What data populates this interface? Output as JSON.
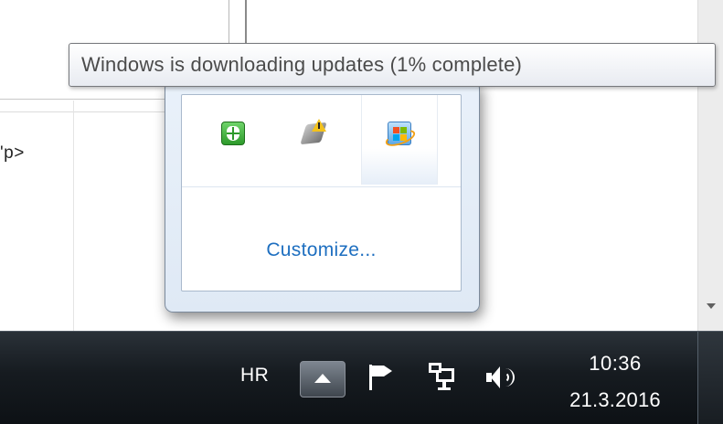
{
  "background": {
    "code_snippet": "'p>"
  },
  "tooltip": {
    "text": "Windows is downloading updates (1% complete)"
  },
  "flyout": {
    "icons": [
      {
        "name": "security-shield-icon"
      },
      {
        "name": "warning-icon"
      },
      {
        "name": "windows-update-icon"
      }
    ],
    "customize_label": "Customize..."
  },
  "taskbar": {
    "language": "HR",
    "clock": {
      "time": "10:36",
      "date": "21.3.2016"
    }
  },
  "colors": {
    "link": "#1e6fc0",
    "taskbar": "#161b20",
    "tooltip_text": "#4b4b4b"
  }
}
